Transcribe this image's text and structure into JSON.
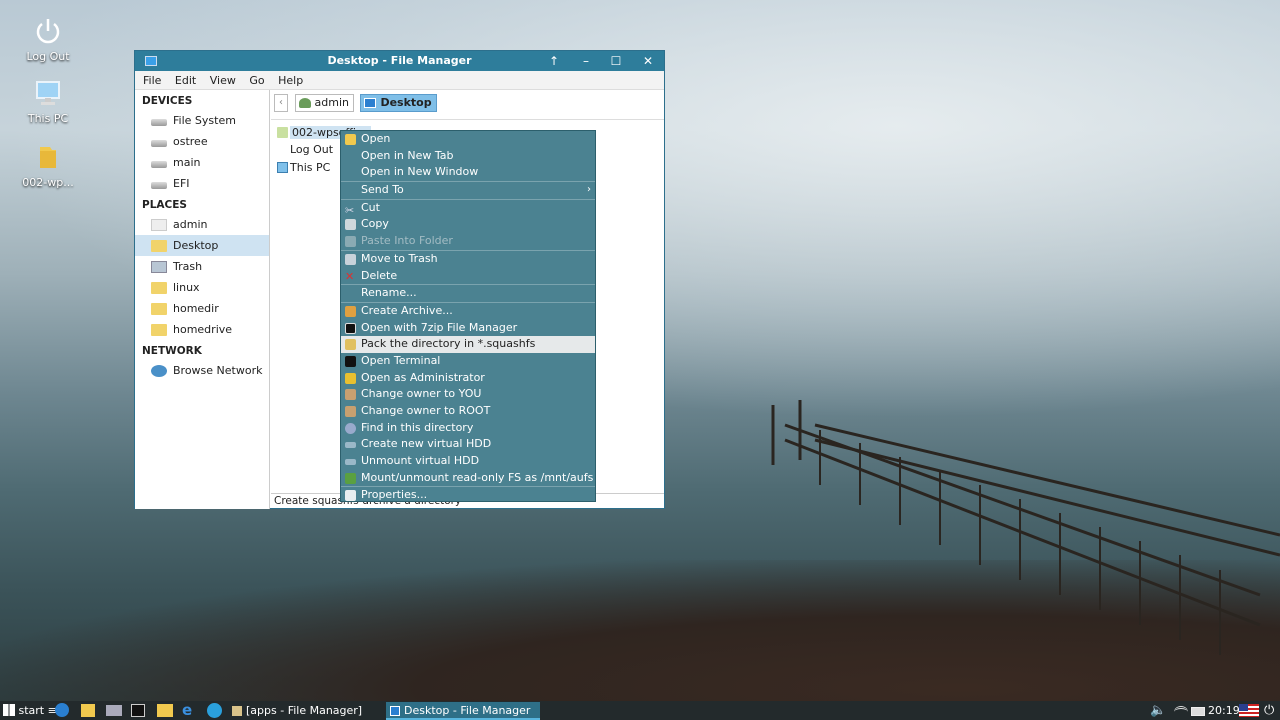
{
  "desktop": {
    "icons": [
      {
        "label": "Log Out",
        "icon": "power-icon"
      },
      {
        "label": "This PC",
        "icon": "computer-icon"
      },
      {
        "label": "002-wp...",
        "icon": "folder-icon"
      }
    ]
  },
  "window": {
    "title": "Desktop - File Manager",
    "menu": [
      "File",
      "Edit",
      "View",
      "Go",
      "Help"
    ],
    "sidebar": {
      "devices_header": "DEVICES",
      "devices": [
        "File System",
        "ostree",
        "main",
        "EFI"
      ],
      "places_header": "PLACES",
      "places": [
        "admin",
        "Desktop",
        "Trash",
        "linux",
        "homedir",
        "homedrive"
      ],
      "network_header": "NETWORK",
      "network": [
        "Browse Network"
      ]
    },
    "path": [
      "admin",
      "Desktop"
    ],
    "files": [
      "002-wpsoffice",
      "Log Out",
      "This PC"
    ],
    "status": "Create squashfs-archive a directory"
  },
  "context_menu": {
    "items": [
      {
        "label": "Open"
      },
      {
        "label": "Open in New Tab"
      },
      {
        "label": "Open in New Window"
      },
      {
        "label": "Send To"
      },
      {
        "label": "Cut"
      },
      {
        "label": "Copy"
      },
      {
        "label": "Paste Into Folder"
      },
      {
        "label": "Move to Trash"
      },
      {
        "label": "Delete"
      },
      {
        "label": "Rename..."
      },
      {
        "label": "Create Archive..."
      },
      {
        "label": "Open with 7zip File Manager"
      },
      {
        "label": "Pack the directory in *.squashfs"
      },
      {
        "label": "Open Terminal"
      },
      {
        "label": "Open as Administrator"
      },
      {
        "label": "Change owner to YOU"
      },
      {
        "label": "Change owner to ROOT"
      },
      {
        "label": "Find in this directory"
      },
      {
        "label": "Create new virtual HDD"
      },
      {
        "label": "Unmount virtual HDD"
      },
      {
        "label": "Mount/unmount read-only FS as /mnt/aufs"
      },
      {
        "label": "Properties..."
      }
    ]
  },
  "taskbar": {
    "start": "start",
    "tasks": [
      "[apps - File Manager]",
      "Desktop - File Manager"
    ],
    "clock": "20:19"
  }
}
